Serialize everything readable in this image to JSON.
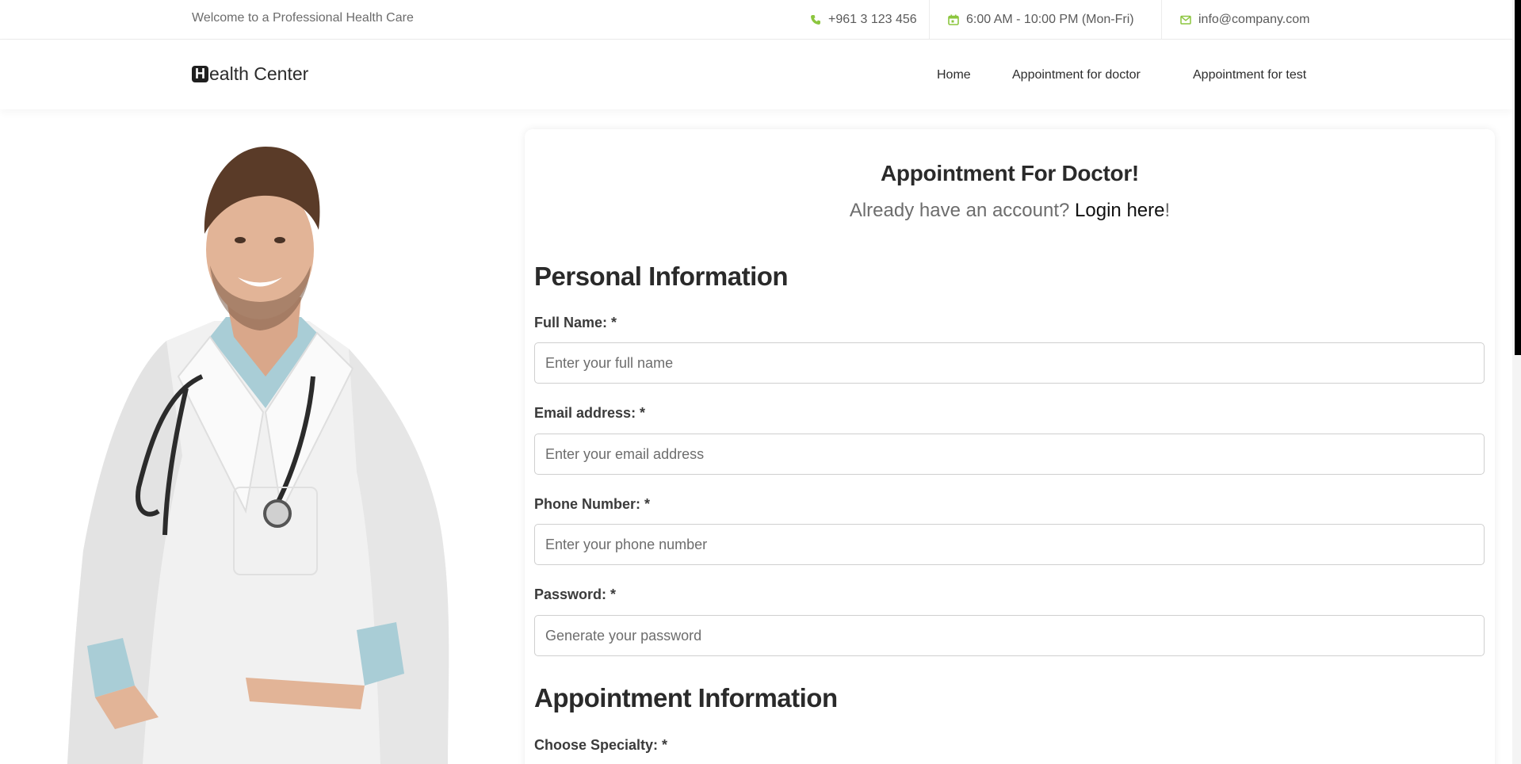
{
  "topbar": {
    "welcome": "Welcome to a Professional Health Care",
    "phone": "+961 3 123 456",
    "hours": "6:00 AM - 10:00 PM (Mon-Fri)",
    "email": "info@company.com",
    "icons": [
      "phone-icon",
      "calendar-icon",
      "envelope-icon"
    ],
    "icon_color": "#8cc63f"
  },
  "header": {
    "logo_mark": "H",
    "logo_text": "ealth Center",
    "nav": [
      "Home",
      "Appointment for doctor",
      "Appointment for test"
    ]
  },
  "form": {
    "title": "Appointment For Doctor!",
    "subtitle_prefix": "Already have an account? ",
    "login_link": "Login here",
    "subtitle_suffix": "!",
    "personal_title": "Personal Information",
    "fields": [
      {
        "label": "Full Name: *",
        "placeholder": "Enter your full name"
      },
      {
        "label": "Email address: *",
        "placeholder": "Enter your email address"
      },
      {
        "label": "Phone Number: *",
        "placeholder": "Enter your phone number"
      },
      {
        "label": "Password: *",
        "placeholder": "Generate your password"
      }
    ],
    "appointment_title": "Appointment Information",
    "specialty_label": "Choose Specialty: *"
  }
}
